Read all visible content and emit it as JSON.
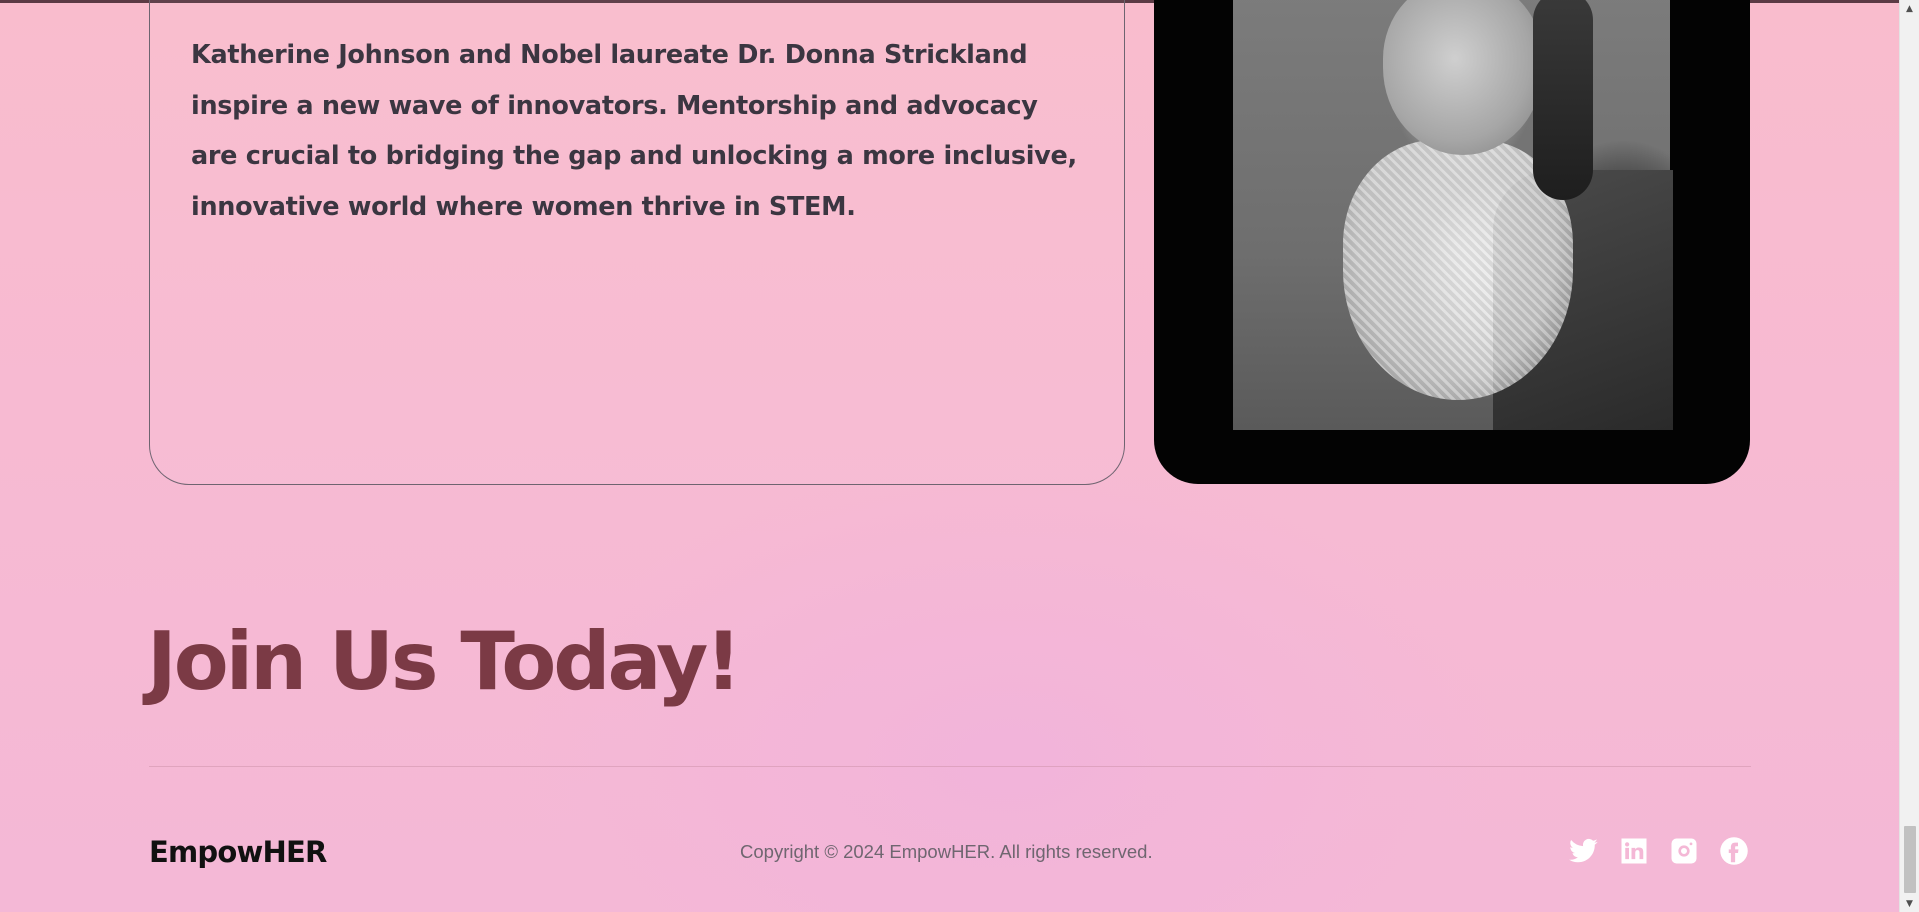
{
  "article": {
    "paragraph": "Katherine Johnson and Nobel laureate Dr. Donna Strickland inspire a new wave of innovators. Mentorship and advocacy are crucial to bridging the gap and unlocking a more inclusive, innovative world where women thrive in STEM."
  },
  "cta": {
    "title": "Join Us Today!"
  },
  "footer": {
    "brand": "EmpowHER",
    "copyright": "Copyright © 2024 EmpowHER. All rights reserved.",
    "socials": [
      {
        "icon": "twitter-icon"
      },
      {
        "icon": "linkedin-icon"
      },
      {
        "icon": "instagram-icon"
      },
      {
        "icon": "facebook-icon"
      }
    ]
  },
  "scrollbar": {
    "up_glyph": "▲",
    "down_glyph": "▼"
  },
  "colors": {
    "background": "#f7bad2",
    "heading": "#7b3a45",
    "body_text": "#3b3641",
    "brand_text": "#111111",
    "copyright_text": "#6f6670",
    "icon": "#ffffff"
  }
}
